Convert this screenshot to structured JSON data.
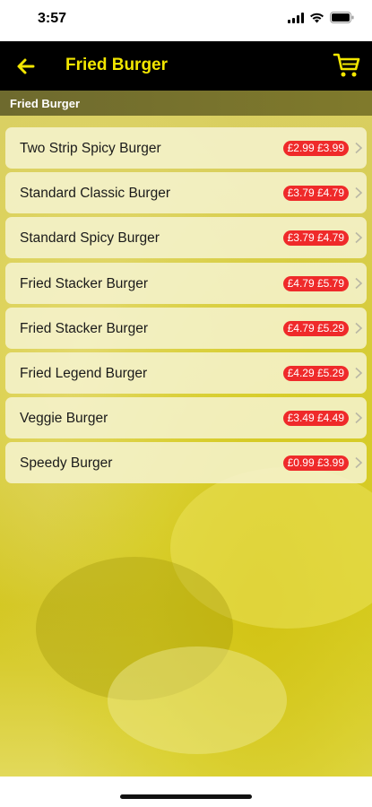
{
  "status": {
    "time": "3:57"
  },
  "nav": {
    "title": "Fried Burger"
  },
  "section": {
    "title": "Fried Burger"
  },
  "items": [
    {
      "name": "Two Strip Spicy Burger",
      "price": "£2.99 £3.99"
    },
    {
      "name": "Standard Classic Burger",
      "price": "£3.79 £4.79"
    },
    {
      "name": "Standard Spicy Burger",
      "price": "£3.79 £4.79"
    },
    {
      "name": "Fried Stacker Burger",
      "price": "£4.79 £5.79"
    },
    {
      "name": "Fried Stacker Burger",
      "price": "£4.79 £5.29"
    },
    {
      "name": "Fried Legend Burger",
      "price": "£4.29 £5.29"
    },
    {
      "name": "Veggie Burger",
      "price": "£3.49 £4.49"
    },
    {
      "name": "Speedy Burger",
      "price": "£0.99 £3.99"
    }
  ],
  "colors": {
    "accent": "#f2e600",
    "navbar": "#000000",
    "badge": "#ef2a2a"
  },
  "icons": {
    "back": "arrow-left-icon",
    "cart": "cart-icon",
    "chevron": "chevron-right-icon"
  }
}
